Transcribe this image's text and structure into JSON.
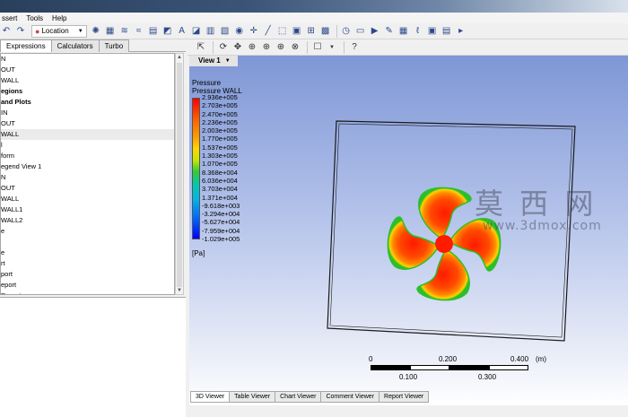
{
  "menu": [
    "ssert",
    "Tools",
    "Help"
  ],
  "toolbar": {
    "location_label": "Location"
  },
  "left_panel": {
    "tabs": [
      {
        "label": "Expressions",
        "active": true
      },
      {
        "label": "Calculators",
        "active": false
      },
      {
        "label": "Turbo",
        "active": false
      }
    ],
    "tree": [
      {
        "text": "N",
        "bold": false
      },
      {
        "text": "OUT",
        "bold": false
      },
      {
        "text": "WALL",
        "bold": false
      },
      {
        "text": "egions",
        "bold": true
      },
      {
        "text": "and Plots",
        "bold": true
      },
      {
        "text": "IN",
        "bold": false
      },
      {
        "text": "OUT",
        "bold": false
      },
      {
        "text": "WALL",
        "bold": false,
        "selected": true
      },
      {
        "text": "l",
        "bold": false
      },
      {
        "text": "form",
        "bold": false
      },
      {
        "text": "egend View 1",
        "bold": false
      },
      {
        "text": "N",
        "bold": false
      },
      {
        "text": "OUT",
        "bold": false
      },
      {
        "text": "WALL",
        "bold": false
      },
      {
        "text": "WALL1",
        "bold": false
      },
      {
        "text": "WALL2",
        "bold": false
      },
      {
        "text": "e",
        "bold": false
      },
      {
        "text": "",
        "bold": false
      },
      {
        "text": "e",
        "bold": false
      },
      {
        "text": "rt",
        "bold": false
      },
      {
        "text": "port",
        "bold": false
      },
      {
        "text": "eport",
        "bold": false
      },
      {
        "text": "Report",
        "bold": false
      }
    ]
  },
  "viewer": {
    "view_label": "View 1",
    "legend": {
      "title": "Pressure",
      "variable": "Pressure WALL",
      "ticks": [
        "2.936e+005",
        "2.703e+005",
        "2.470e+005",
        "2.236e+005",
        "2.003e+005",
        "1.770e+005",
        "1.537e+005",
        "1.303e+005",
        "1.070e+005",
        "8.368e+004",
        "6.036e+004",
        "3.703e+004",
        "1.371e+004",
        "-9.618e+003",
        "-3.294e+004",
        "-5.627e+004",
        "-7.959e+004",
        "-1.029e+005"
      ],
      "unit": "[Pa]"
    },
    "scale": {
      "top_labels": [
        "0",
        "0.200",
        "0.400",
        "(m)"
      ],
      "bottom_labels": [
        "0.100",
        "0.300"
      ]
    },
    "bottom_tabs": [
      {
        "label": "3D Viewer",
        "active": true
      },
      {
        "label": "Table Viewer",
        "active": false
      },
      {
        "label": "Chart Viewer",
        "active": false
      },
      {
        "label": "Comment Viewer",
        "active": false
      },
      {
        "label": "Report Viewer",
        "active": false
      }
    ],
    "watermark": {
      "chars": "莫 西 网",
      "url": "www.3dmox.com"
    }
  },
  "colors": {
    "canvas_top": "#7f97d6",
    "accent_red": "#ff0000"
  }
}
